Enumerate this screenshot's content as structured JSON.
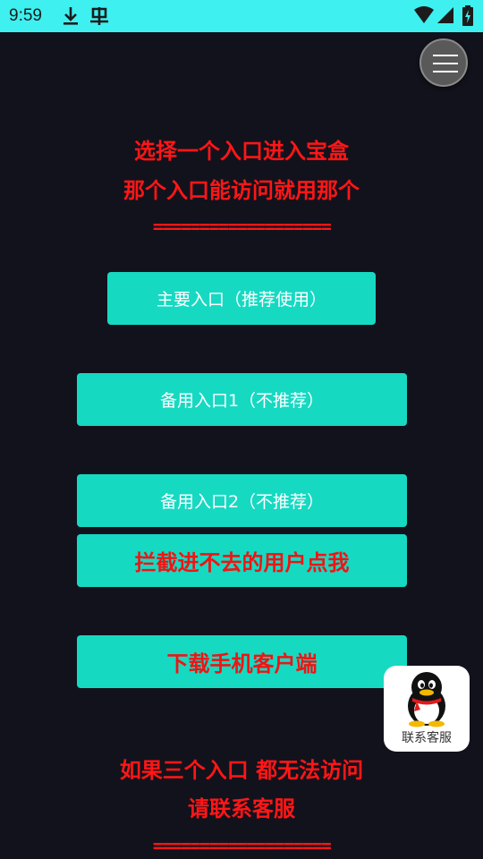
{
  "status_bar": {
    "time": "9:59",
    "left_icons": [
      "download-icon",
      "app-notification-icon"
    ],
    "right_icons": [
      "wifi-icon",
      "signal-icon",
      "battery-icon"
    ],
    "background": "#3ef0f0"
  },
  "header": {
    "menu_icon": "hamburger-menu-icon",
    "line1": "选择一个入口进入宝盒",
    "line2": "那个入口能访问就用那个",
    "divider": "==================="
  },
  "buttons": {
    "primary": "主要入口（推荐使用）",
    "backup1": "备用入口1（不推荐）",
    "backup2": "备用入口2（不推荐）",
    "blocked": "拦截进不去的用户点我",
    "download": "下载手机客户端"
  },
  "footer": {
    "line1": "如果三个入口 都无法访问",
    "line2": "请联系客服",
    "divider": "==================="
  },
  "support": {
    "icon": "qq-penguin-icon",
    "label": "联系客服"
  },
  "colors": {
    "background": "#12121c",
    "accent": "#16d9c2",
    "warning_text": "#ff1616"
  }
}
